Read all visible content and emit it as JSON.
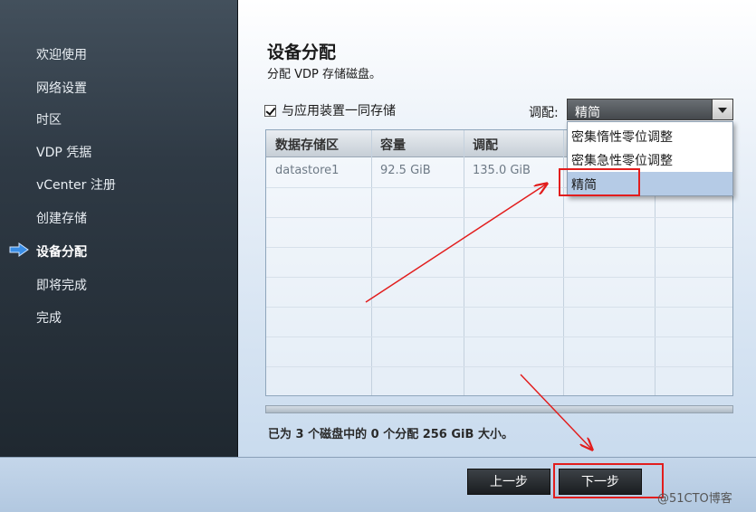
{
  "sidebar": {
    "items": [
      {
        "label": "欢迎使用"
      },
      {
        "label": "网络设置"
      },
      {
        "label": "时区"
      },
      {
        "label": "VDP 凭据"
      },
      {
        "label": "vCenter 注册"
      },
      {
        "label": "创建存储"
      },
      {
        "label": "设备分配"
      },
      {
        "label": "即将完成"
      },
      {
        "label": "完成"
      }
    ],
    "active_index": 6
  },
  "main": {
    "title": "设备分配",
    "subtitle": "分配 VDP 存储磁盘。",
    "store_with_appliance_label": "与应用装置一同存储",
    "store_with_appliance_checked": true,
    "provisioning_label": "调配:",
    "provisioning_value": "精简",
    "provisioning_options": [
      "密集惰性零位调整",
      "密集急性零位调整",
      "精简"
    ],
    "table": {
      "columns": [
        "数据存储区",
        "容量",
        "调配"
      ],
      "rows": [
        [
          "datastore1",
          "92.5 GiB",
          "135.0 GiB"
        ]
      ]
    },
    "status": "已为 3 个磁盘中的 0 个分配 256 GiB 大小。"
  },
  "footer": {
    "back_label": "上一步",
    "next_label": "下一步"
  },
  "watermark": "@51CTO博客",
  "colors": {
    "annotation_red": "#e21d1d",
    "selected_option": "#b5cbe6",
    "active_arrow": "#3a8ee6"
  }
}
